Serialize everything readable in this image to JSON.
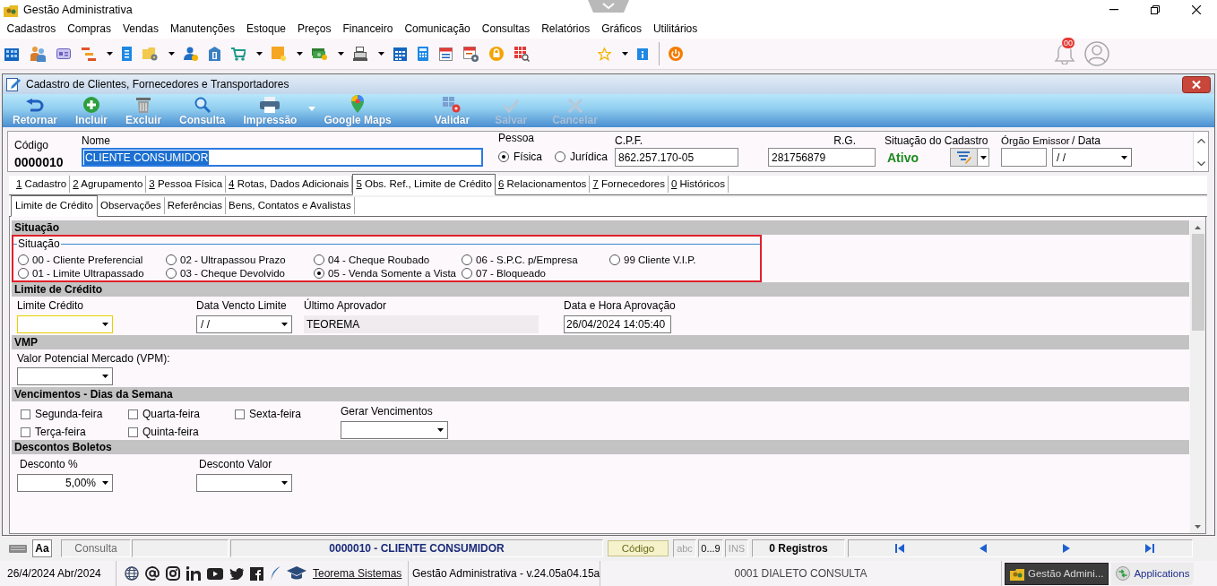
{
  "app": {
    "title": "Gestão Administrativa"
  },
  "menu": [
    "Cadastros",
    "Compras",
    "Vendas",
    "Manutenções",
    "Estoque",
    "Preços",
    "Financeiro",
    "Comunicação",
    "Consultas",
    "Relatórios",
    "Gráficos",
    "Utilitários"
  ],
  "notifications": {
    "badge": "00"
  },
  "window": {
    "title": "Cadastro de Clientes, Fornecedores e Transportadores"
  },
  "actions": [
    {
      "label": "Retornar",
      "disabled": false,
      "dropdown": false
    },
    {
      "label": "Incluir",
      "disabled": false,
      "dropdown": false
    },
    {
      "label": "Excluir",
      "disabled": false,
      "dropdown": false
    },
    {
      "label": "Consulta",
      "disabled": false,
      "dropdown": false
    },
    {
      "label": "Impressão",
      "disabled": false,
      "dropdown": true
    },
    {
      "label": "Google Maps",
      "disabled": false,
      "dropdown": false
    },
    {
      "label": "Validar",
      "disabled": false,
      "dropdown": false
    },
    {
      "label": "Salvar",
      "disabled": true,
      "dropdown": false
    },
    {
      "label": "Cancelar",
      "disabled": true,
      "dropdown": false
    }
  ],
  "header": {
    "fields": [
      {
        "kind": "display",
        "label": "Código",
        "value": "0000010"
      },
      {
        "kind": "text",
        "label": "Nome",
        "value": "CLIENTE CONSUMIDOR",
        "text_selected": true
      },
      {
        "kind": "radio",
        "label": "Pessoa",
        "options": [
          {
            "label": "Física",
            "selected": true
          },
          {
            "label": "Jurídica",
            "selected": false
          }
        ]
      },
      {
        "kind": "text",
        "label": "C.P.F.",
        "value": "862.257.170-05",
        "text_selected": false
      },
      {
        "kind": "text",
        "label": "R.G.",
        "value": "281756879",
        "text_selected": false
      },
      {
        "kind": "status",
        "label": "Situação do Cadastro",
        "value": "Ativo"
      },
      {
        "kind": "text",
        "label": "Órgão Emissor",
        "text_selected": false
      },
      {
        "kind": "date",
        "label": "/ Data",
        "value": "/ /"
      }
    ]
  },
  "tabs": [
    {
      "label": "1 Cadastro",
      "selected": false
    },
    {
      "label": "2 Agrupamento",
      "selected": false
    },
    {
      "label": "3 Pessoa Física",
      "selected": false
    },
    {
      "label": "4 Rotas, Dados Adicionais",
      "selected": false
    },
    {
      "label": "5 Obs. Ref., Limite de Crédito",
      "selected": true
    },
    {
      "label": "6 Relacionamentos",
      "selected": false
    },
    {
      "label": "7 Fornecedores",
      "selected": false
    },
    {
      "label": "0 Históricos",
      "selected": false
    }
  ],
  "subtabs": [
    {
      "label": "Limite de Crédito",
      "selected": true
    },
    {
      "label": "Observações",
      "selected": false
    },
    {
      "label": "Referências",
      "selected": false
    },
    {
      "label": "Bens, Contatos e Avalistas",
      "selected": false
    }
  ],
  "sections": [
    {
      "title": "Situação",
      "kind": "radio_group",
      "legend": "Situação",
      "options": [
        {
          "label": "00 - Cliente Preferencial",
          "selected": false
        },
        {
          "label": "01 - Limite Ultrapassado",
          "selected": false
        },
        {
          "label": "02 - Ultrapassou Prazo",
          "selected": false
        },
        {
          "label": "03 - Cheque Devolvido",
          "selected": false
        },
        {
          "label": "04 - Cheque Roubado",
          "selected": false
        },
        {
          "label": "05 - Venda Somente a Vista",
          "selected": true
        },
        {
          "label": "06 - S.P.C. p/Empresa",
          "selected": false
        },
        {
          "label": "07 - Bloqueado",
          "selected": false
        },
        {
          "label": "99 Cliente V.I.P.",
          "selected": false
        }
      ]
    },
    {
      "title": "Limite de Crédito",
      "kind": "fields",
      "fields": [
        {
          "kind": "dropdown",
          "label": "Limite Crédito",
          "highlighted": true
        },
        {
          "kind": "dropdown",
          "label": "Data Vencto Limite",
          "value": "/ /",
          "highlighted": false
        },
        {
          "kind": "readonly",
          "label": "Último Aprovador",
          "value": "TEOREMA"
        },
        {
          "kind": "text",
          "label": "Data e Hora Aprovação",
          "value": "26/04/2024 14:05:40"
        }
      ]
    },
    {
      "title": "VMP",
      "kind": "fields",
      "fields": [
        {
          "kind": "dropdown",
          "label": "Valor Potencial Mercado (VPM):",
          "highlighted": false
        }
      ]
    },
    {
      "title": "Vencimentos - Dias da Semana",
      "kind": "checks",
      "options": [
        {
          "label": "Segunda-feira",
          "checked": false
        },
        {
          "label": "Terça-feira",
          "checked": false
        },
        {
          "label": "Quarta-feira",
          "checked": false
        },
        {
          "label": "Quinta-feira",
          "checked": false
        },
        {
          "label": "Sexta-feira",
          "checked": false
        }
      ],
      "field": {
        "kind": "dropdown",
        "label": "Gerar Vencimentos",
        "highlighted": false
      }
    },
    {
      "title": "Descontos Boletos",
      "kind": "fields",
      "fields": [
        {
          "kind": "dropdown",
          "label": "Desconto %",
          "value": "5,00%",
          "highlighted": false
        },
        {
          "kind": "dropdown",
          "label": "Desconto Valor",
          "highlighted": false
        }
      ]
    }
  ],
  "status_bar": {
    "font_button": "Aa",
    "mode": "Consulta",
    "record": "0000010 - CLIENTE CONSUMIDOR",
    "key_button": "Código",
    "indicators": [
      {
        "label": "abc",
        "on": false
      },
      {
        "label": "0...9",
        "on": true
      },
      {
        "label": "INS",
        "on": false
      }
    ],
    "count": "0 Registros"
  },
  "footer": {
    "date": "26/4/2024 Abr/2024",
    "link": "Teorema Sistemas",
    "version": "Gestão Administrativa - v.24.05a04.15a",
    "company": "0001 DIALETO CONSULTA",
    "taskbar": [
      {
        "label": "Gestão Admini...",
        "selected": true
      },
      {
        "label": "Applications",
        "selected": false
      }
    ]
  }
}
